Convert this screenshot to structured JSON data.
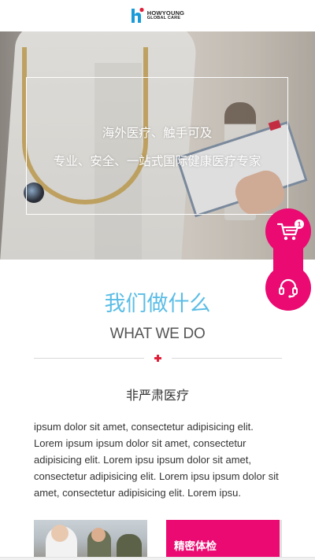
{
  "header": {
    "logo_line1": "HOWYOUNG",
    "logo_line2": "GLOBAL CARE",
    "logo_icon": "h-logo-icon"
  },
  "hero": {
    "line1": "海外医疗、触手可及",
    "line2": "专业、安全、一站式国际健康医疗专家"
  },
  "floating": {
    "cart_icon": "cart-icon",
    "cart_count": "1",
    "service_icon": "headset-icon"
  },
  "what_we_do": {
    "title_cn": "我们做什么",
    "title_en": "WHAT WE DO",
    "subtitle": "非严肃医疗",
    "description": "ipsum dolor sit amet, consectetur adipisicing elit. Lorem ipsum ipsum dolor sit amet, consectetur adipisicing elit. Lorem ipsu ipsum dolor sit amet, consectetur adipisicing elit. Lorem ipsu ipsum dolor sit amet, consectetur adipisicing elit. Lorem ipsu."
  },
  "cards": {
    "card1_label": "精密体检"
  },
  "colors": {
    "accent_pink": "#ea0a71",
    "title_blue": "#5bbde6",
    "cross_red": "#e0203a"
  }
}
